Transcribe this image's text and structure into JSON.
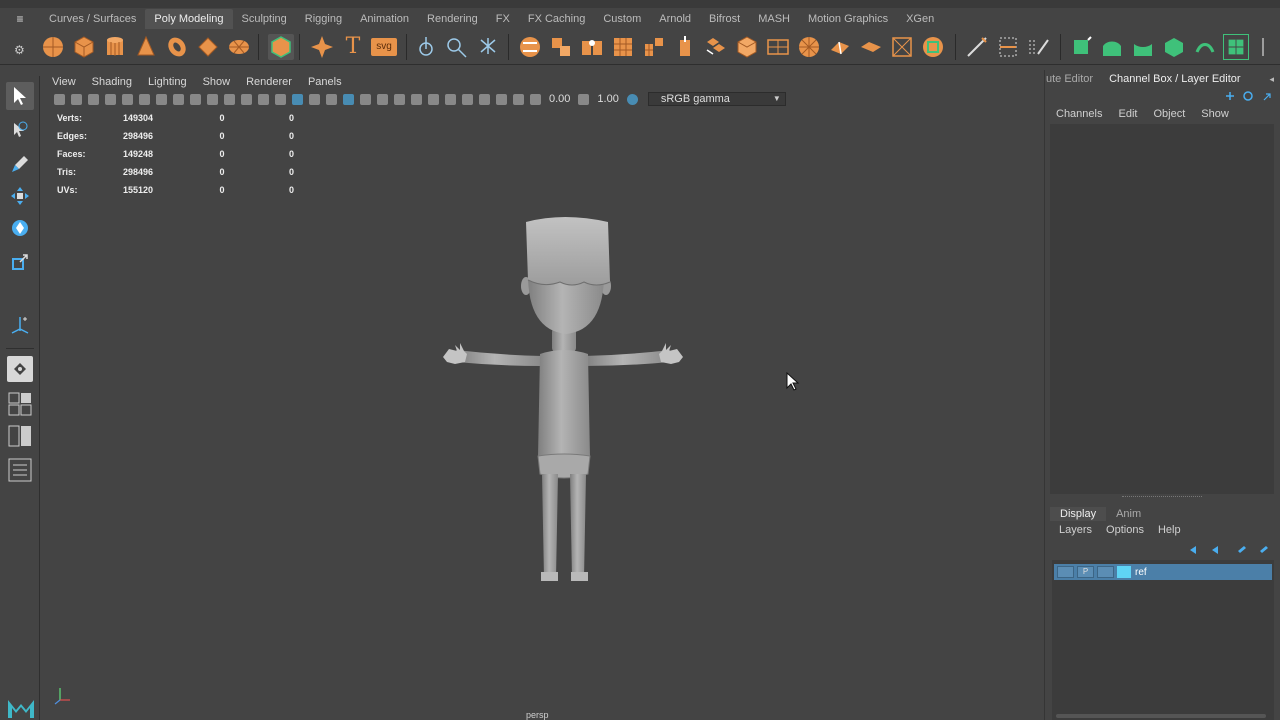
{
  "shelf": {
    "tabs": [
      "Curves / Surfaces",
      "Poly Modeling",
      "Sculpting",
      "Rigging",
      "Animation",
      "Rendering",
      "FX",
      "FX Caching",
      "Custom",
      "Arnold",
      "Bifrost",
      "MASH",
      "Motion Graphics",
      "XGen"
    ],
    "active_tab": "Poly Modeling",
    "text_icon_label": "T",
    "svg_icon_label": "svg"
  },
  "viewport": {
    "menu": [
      "View",
      "Shading",
      "Lighting",
      "Show",
      "Renderer",
      "Panels"
    ],
    "exposure_value": "0.00",
    "gamma_value": "1.00",
    "color_space": "sRGB gamma",
    "camera_label": "persp",
    "hud": [
      {
        "label": "Verts:",
        "v1": "149304",
        "v2": "0",
        "v3": "0"
      },
      {
        "label": "Edges:",
        "v1": "298496",
        "v2": "0",
        "v3": "0"
      },
      {
        "label": "Faces:",
        "v1": "149248",
        "v2": "0",
        "v3": "0"
      },
      {
        "label": "Tris:",
        "v1": "298496",
        "v2": "0",
        "v3": "0"
      },
      {
        "label": "UVs:",
        "v1": "155120",
        "v2": "0",
        "v3": "0"
      }
    ]
  },
  "right_panel": {
    "tabs": [
      "ute Editor",
      "Channel Box / Layer Editor"
    ],
    "active_tab": "Channel Box / Layer Editor",
    "channel_menu": [
      "Channels",
      "Edit",
      "Object",
      "Show"
    ],
    "layer_tabs": [
      "Display",
      "Anim"
    ],
    "active_layer_tab": "Display",
    "layer_menu": [
      "Layers",
      "Options",
      "Help"
    ],
    "layers": [
      {
        "flag": "P",
        "name": "ref",
        "color": "#5fd4f5"
      }
    ]
  },
  "colors": {
    "accent_orange": "#e8934a",
    "accent_green": "#3fc17a",
    "selection_blue": "#4b7fa8",
    "background": "#444444"
  }
}
